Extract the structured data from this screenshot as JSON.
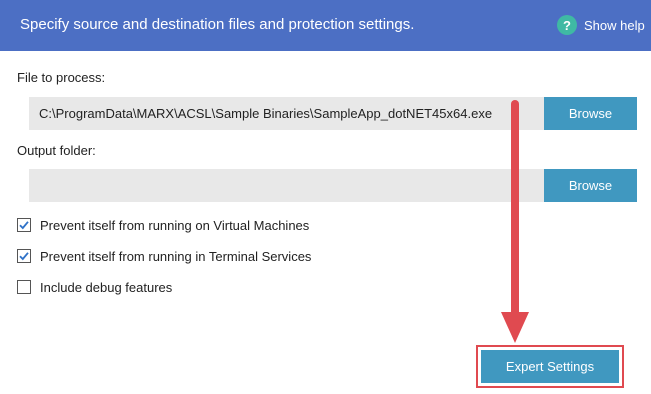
{
  "header": {
    "title": "Specify source and destination files and protection settings.",
    "help_icon": "question-circle-icon",
    "help_label": "Show help",
    "background_color": "#4c6fc4"
  },
  "file_to_process": {
    "label": "File to process:",
    "value": "C:\\ProgramData\\MARX\\ACSL\\Sample Binaries\\SampleApp_dotNET45x64.exe",
    "browse_label": "Browse"
  },
  "output_folder": {
    "label": "Output folder:",
    "value": "",
    "browse_label": "Browse"
  },
  "options": [
    {
      "label": "Prevent itself from running on Virtual Machines",
      "checked": true
    },
    {
      "label": "Prevent itself from running in Terminal Services",
      "checked": true
    },
    {
      "label": "Include debug features",
      "checked": false
    }
  ],
  "expert_settings": {
    "label": "Expert Settings",
    "highlight_color": "#e04a50"
  },
  "annotation": {
    "arrow_icon": "down-arrow-annotation",
    "color": "#e04a50"
  },
  "colors": {
    "button": "#4098c0",
    "input_background": "#e8e8e8"
  }
}
